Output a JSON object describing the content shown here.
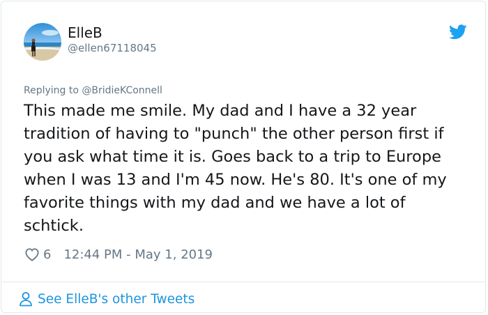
{
  "tweet": {
    "author": {
      "name": "ElleB",
      "handle": "@ellen67118045",
      "avatar_icon": "beach-photo-avatar"
    },
    "platform_icon": "twitter-bird-icon",
    "brand_color": "#1da1f2",
    "replying_prefix": "Replying to",
    "replying_to": "@BridieKConnell",
    "text": "This made me smile. My dad and I have a 32 year tradition of having to \"punch\" the other person first if you ask what time it is. Goes back to a trip to Europe when I was 13 and I'm 45 now. He's 80. It's one of my favorite things with my dad and we have a lot of schtick.",
    "likes": "6",
    "like_icon": "heart-icon",
    "timestamp": "12:44 PM - May 1, 2019"
  },
  "footer": {
    "see_more_label": "See ElleB's other Tweets",
    "see_more_icon": "person-icon",
    "link_color": "#1b95e0"
  }
}
